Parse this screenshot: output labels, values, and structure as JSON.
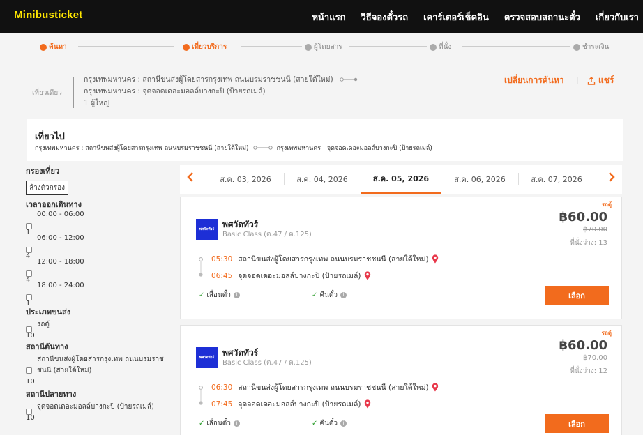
{
  "header": {
    "logo": "Minibusticket",
    "nav": [
      "หน้าแรก",
      "วิธีจองตั๋วรถ",
      "เคาร์เตอร์เช็คอิน",
      "ตรวจสอบสถานะตั๋ว",
      "เกี่ยวกับเรา"
    ]
  },
  "steps": [
    "ค้นหา",
    "เที่ยวบริการ",
    "ผู้โดยสาร",
    "ที่นั่ง",
    "ชำระเงิน"
  ],
  "summary": {
    "trip_type": "เที่ยวเดียว",
    "origin": "กรุงเทพมหานคร : สถานีขนส่งผู้โดยสารกรุงเทพ ถนนบรมราชชนนี (สายใต้ใหม่)",
    "destination": "กรุงเทพมหานคร : จุดจอดเดอะมอลล์บางกะปิ (ป้ายรถเมล์)",
    "passengers": "1 ผู้ใหญ่",
    "change_search": "เปลี่ยนการค้นหา",
    "share": "แชร์"
  },
  "tripbox": {
    "title": "เที่ยวไป",
    "origin": "กรุงเทพมหานคร : สถานีขนส่งผู้โดยสารกรุงเทพ ถนนบรมราชชนนี (สายใต้ใหม่)",
    "destination": "กรุงเทพมหานคร : จุดจอดเดอะมอลล์บางกะปิ (ป้ายรถเมล์)"
  },
  "filters": {
    "title": "กรองเที่ยว",
    "clear": "ล้างตัวกรอง",
    "departure_title": "เวลาออกเดินทาง",
    "departure": [
      {
        "label": "00:00 - 06:00",
        "count": "1"
      },
      {
        "label": "06:00 - 12:00",
        "count": "4"
      },
      {
        "label": "12:00 - 18:00",
        "count": "4"
      },
      {
        "label": "18:00 - 24:00",
        "count": "1"
      }
    ],
    "vehicle_title": "ประเภทขนส่ง",
    "vehicle": [
      {
        "label": "รถตู้",
        "count": "10"
      }
    ],
    "origin_title": "สถานีต้นทาง",
    "origin": [
      {
        "label": "สถานีขนส่งผู้โดยสารกรุงเทพ ถนนบรมราชชนนี (สายใต้ใหม่)",
        "count": "10"
      }
    ],
    "dest_title": "สถานีปลายทาง",
    "dest": [
      {
        "label": "จุดจอดเดอะมอลล์บางกะปิ (ป้ายรถเมล์)",
        "count": "10"
      }
    ]
  },
  "dates": [
    "ส.ค. 03, 2026",
    "ส.ค. 04, 2026",
    "ส.ค. 05, 2026",
    "ส.ค. 06, 2026",
    "ส.ค. 07, 2026"
  ],
  "active_date_index": 2,
  "trips": [
    {
      "badge": "รถตู้",
      "operator_logo": "พศวัดทัวร์",
      "operator": "พศวัดทัวร์",
      "class": "Basic Class (ต.47 / ต.125)",
      "price": "฿60.00",
      "old_price": "฿70.00",
      "seats": "ที่นั่งว่าง: 13",
      "dep_time": "05:30",
      "dep_place": "สถานีขนส่งผู้โดยสารกรุงเทพ ถนนบรมราชชนนี (สายใต้ใหม่)",
      "arr_time": "06:45",
      "arr_place": "จุดจอดเดอะมอลล์บางกะปิ (ป้ายรถเมล์)",
      "perk1": "เลื่อนตั๋ว",
      "perk2": "คืนตั๋ว",
      "select": "เลือก"
    },
    {
      "badge": "รถตู้",
      "operator_logo": "พศวัดทัวร์",
      "operator": "พศวัดทัวร์",
      "class": "Basic Class (ต.47 / ต.125)",
      "price": "฿60.00",
      "old_price": "฿70.00",
      "seats": "ที่นั่งว่าง: 12",
      "dep_time": "06:30",
      "dep_place": "สถานีขนส่งผู้โดยสารกรุงเทพ ถนนบรมราชชนนี (สายใต้ใหม่)",
      "arr_time": "07:45",
      "arr_place": "จุดจอดเดอะมอลล์บางกะปิ (ป้ายรถเมล์)",
      "perk1": "เลื่อนตั๋ว",
      "perk2": "คืนตั๋ว",
      "select": "เลือก"
    }
  ],
  "colors": {
    "accent": "#f26b1d",
    "header_bg": "#111111",
    "logo": "#ffe600",
    "operator": "#1d2fd6",
    "check": "#2a9d2a"
  }
}
